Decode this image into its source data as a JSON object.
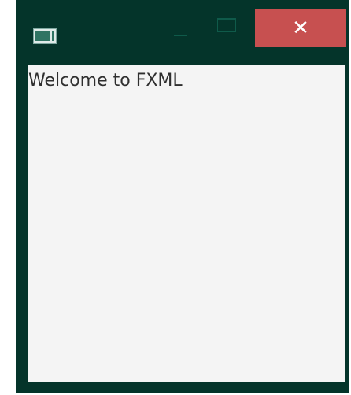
{
  "window": {
    "title_icon": "java-app-icon",
    "controls": {
      "minimize_icon": "minimize-icon",
      "maximize_icon": "maximize-icon",
      "close_icon": "close-icon",
      "close_glyph": "✕"
    },
    "colors": {
      "frame": "#04342a",
      "close_button": "#c75050",
      "content_background": "#f4f4f4",
      "text": "#2e2e2e"
    }
  },
  "content": {
    "label": "Welcome to FXML"
  }
}
